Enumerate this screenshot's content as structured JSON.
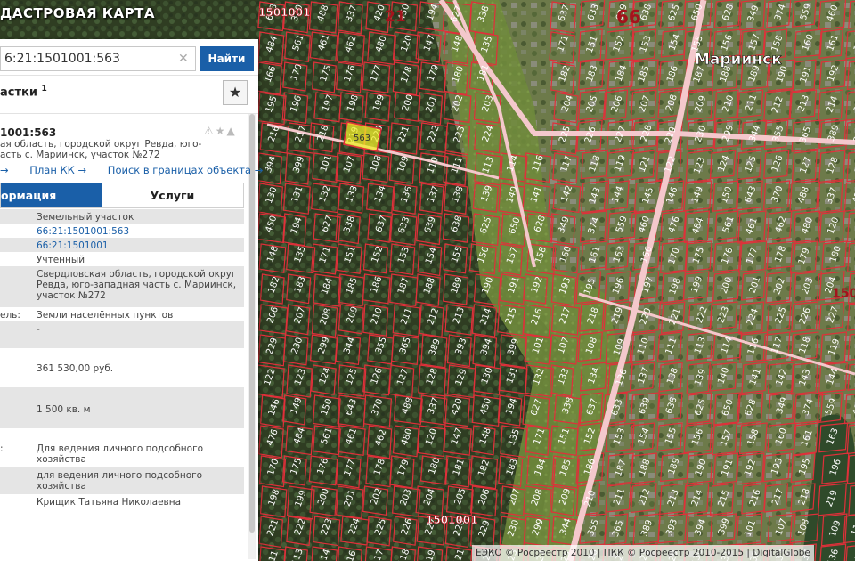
{
  "app_title": "ДАСТРОВАЯ КАРТА",
  "search": {
    "value": "6:21:1501001:563",
    "find_label": "Найти"
  },
  "section": {
    "title": "астки",
    "superscript": "1"
  },
  "card": {
    "number": "1001:563",
    "address_lines": [
      "ая область, городской округ Ревда, юго-",
      "асть с. Мариинск, участок №272"
    ],
    "links": [
      "→",
      "План КК →",
      "Поиск в границах объекта →"
    ]
  },
  "tabs": {
    "active": "ормация",
    "other": "Услуги"
  },
  "rows": [
    {
      "key": "",
      "value": "Земельный участок",
      "grey": true
    },
    {
      "key": "",
      "value": "66:21:1501001:563",
      "link": true
    },
    {
      "key": "",
      "value": "66:21:1501001",
      "link": true,
      "grey": true
    },
    {
      "key": "",
      "value": "Учтенный"
    },
    {
      "key": "",
      "value": "Свердловская область, городской округ Ревда, юго-западная часть с. Мариинск, участок №272",
      "grey": true
    },
    {
      "key": "ель:",
      "value": "Земли населённых пунктов"
    },
    {
      "key": "",
      "value": "-",
      "grey": true
    },
    {
      "key": "",
      "value": ""
    },
    {
      "key": "",
      "value": "361 530,00 руб."
    },
    {
      "key": "",
      "value": "",
      "grey": true
    },
    {
      "key": "",
      "value": "1 500 кв. м",
      "grey": true
    },
    {
      "key": "",
      "value": ""
    },
    {
      "key": ":",
      "value": "Для ведения личного подсобного хозяйства"
    },
    {
      "key": "",
      "value": "для ведения личного подсобного хозяйства",
      "grey": true
    },
    {
      "key": "",
      "value": "Крищик Татьяна Николаевна"
    }
  ],
  "map_labels": {
    "place": "Мариинск",
    "district_66": "66",
    "district_21": "21",
    "block_1501001": "1501001",
    "selected_parcel": "563",
    "parcels": [
      "643",
      "370",
      "488",
      "337",
      "420",
      "450",
      "194",
      "627",
      "338",
      "637",
      "633",
      "639",
      "638",
      "625",
      "650",
      "628",
      "349",
      "374",
      "559",
      "460",
      "476",
      "484",
      "561",
      "461",
      "462",
      "480",
      "120",
      "147",
      "148",
      "135",
      "171",
      "151",
      "152",
      "153",
      "154",
      "155",
      "156",
      "157",
      "158",
      "160",
      "161",
      "163",
      "166",
      "170",
      "175",
      "176",
      "177",
      "178",
      "179",
      "180",
      "181",
      "182",
      "183",
      "184",
      "185",
      "186",
      "187",
      "188",
      "189",
      "190",
      "191",
      "192",
      "193",
      "195",
      "196",
      "197",
      "198",
      "199",
      "200",
      "201",
      "202",
      "203",
      "204",
      "205",
      "206",
      "207",
      "208",
      "209",
      "210",
      "211",
      "212",
      "213",
      "214",
      "215",
      "216",
      "217",
      "218",
      "219",
      "220",
      "221",
      "222",
      "223",
      "224",
      "225",
      "226",
      "227",
      "228",
      "229",
      "230",
      "299",
      "344",
      "355",
      "365",
      "389",
      "393",
      "394",
      "399",
      "101",
      "107",
      "108",
      "109",
      "110",
      "111",
      "113",
      "114",
      "116",
      "117",
      "118",
      "119",
      "121",
      "122",
      "123",
      "124",
      "125",
      "126",
      "127",
      "128",
      "129",
      "130",
      "131",
      "132",
      "133",
      "134",
      "136",
      "137",
      "138",
      "139",
      "140",
      "141",
      "142",
      "143",
      "144",
      "145",
      "146",
      "149",
      "150"
    ],
    "parcel_zone": "150"
  },
  "footer": "ЕЭКО © Росреестр 2010 | ПКК © Росреестр 2010-2015 | DigitalGlobe",
  "colors": {
    "boundary": "#e0303a",
    "selected": "#f2ee2a",
    "accent": "#1a5fa8",
    "road": "#f4c8cc"
  }
}
